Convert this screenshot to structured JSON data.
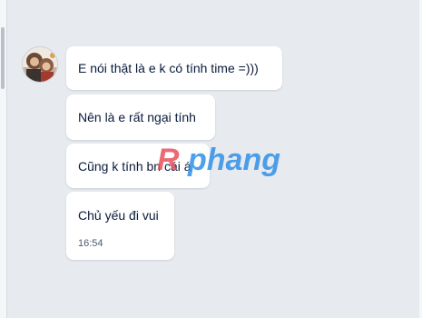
{
  "messages": [
    {
      "text": "E nói thật là e k có tính time =)))"
    },
    {
      "text": "Nên là e rất ngại tính"
    },
    {
      "text": "Cũng k tính bn cái á"
    },
    {
      "text": "Chủ yếu đi vui",
      "time": "16:54"
    }
  ],
  "watermark": {
    "text": "Rphang",
    "colors": {
      "r": "#e8505b",
      "rest": "#2f8fe6"
    }
  }
}
